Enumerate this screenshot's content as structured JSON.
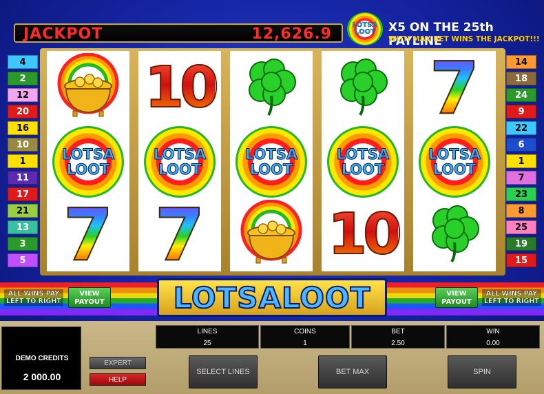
{
  "jackpot": {
    "label": "JACKPOT",
    "value": "12,626.9"
  },
  "jackpot_logo": [
    "LOTSA",
    "LOOT"
  ],
  "promo": {
    "line1": "X5 ON THE 25th PAYLINE",
    "line2": "WITH MAX BET WINS THE JACKPOT!!!"
  },
  "paylines_left": [
    "4",
    "2",
    "12",
    "20",
    "16",
    "10",
    "1",
    "11",
    "17",
    "21",
    "13",
    "3",
    "5"
  ],
  "paylines_right": [
    "14",
    "18",
    "24",
    "9",
    "22",
    "6",
    "1",
    "7",
    "23",
    "8",
    "25",
    "19",
    "15"
  ],
  "payline_colors_left": [
    "#3cc8ff",
    "#2a9a2a",
    "#f2a6f2",
    "#e01a1a",
    "#ffe000",
    "#9a8a40",
    "#ffe000",
    "#5a2ab0",
    "#e01a1a",
    "#9ad040",
    "#38c0a0",
    "#2a9a2a",
    "#c050ff"
  ],
  "payline_colors_right": [
    "#ff9a30",
    "#8a6a3a",
    "#2a9a2a",
    "#e01a1a",
    "#3cc8ff",
    "#1e4cd0",
    "#ffe000",
    "#e070e0",
    "#2ad050",
    "#ff9a30",
    "#ff80c0",
    "#2a7a2a",
    "#e01a1a"
  ],
  "reels": [
    [
      "pot-of-gold",
      "lotsa-loot",
      "seven"
    ],
    [
      "ten",
      "lotsa-loot",
      "seven"
    ],
    [
      "clover",
      "lotsa-loot",
      "pot-of-gold"
    ],
    [
      "clover",
      "lotsa-loot",
      "ten"
    ],
    [
      "seven",
      "lotsa-loot",
      "clover"
    ]
  ],
  "symbol_text": {
    "seven": "7",
    "ten": "10",
    "logo_line1": "LOTSA",
    "logo_line2": "LOOT"
  },
  "title": "LOTSALOOT",
  "side": {
    "all_wins_left": [
      "ALL WINS PAY",
      "LEFT TO RIGHT"
    ],
    "all_wins_right": [
      "ALL WINS PAY",
      "LEFT TO RIGHT"
    ],
    "view_payout_left": [
      "VIEW",
      "PAYOUT"
    ],
    "view_payout_right": [
      "VIEW",
      "PAYOUT"
    ]
  },
  "console": {
    "credits_label": "DEMO CREDITS",
    "credits_value": "2 000.00",
    "expert_label": "EXPERT",
    "help_label": "HELP",
    "lines_label": "LINES",
    "lines_value": "25",
    "coins_label": "COINS",
    "coins_value": "1",
    "bet_label": "BET",
    "bet_value": "2.50",
    "win_label": "WIN",
    "win_value": "0.00",
    "select_lines_label": "SELECT LINES",
    "bet_max_label": "BET MAX",
    "spin_label": "SPIN"
  }
}
